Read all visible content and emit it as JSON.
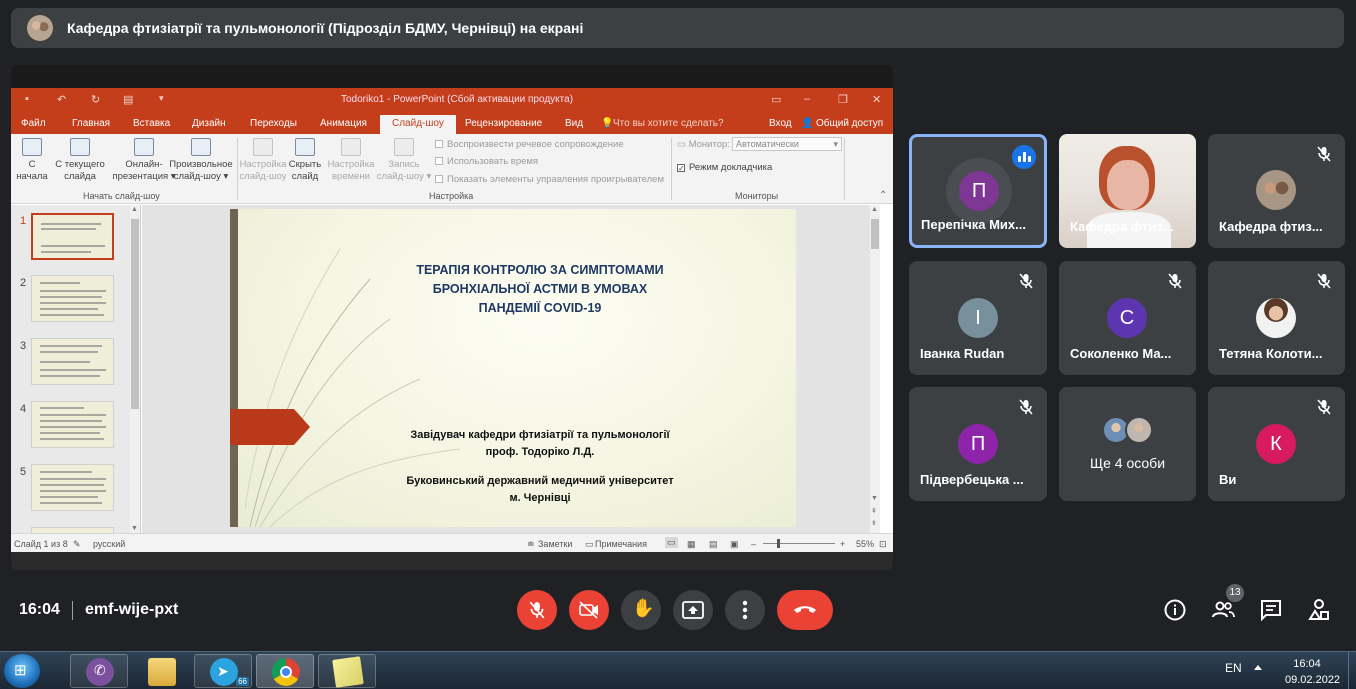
{
  "topbar": {
    "presenting_text": "Кафедра фтизіатрії та пульмонології (Підрозділ БДМУ, Чернівці) на екрані"
  },
  "ppt": {
    "window_title": "Todoriko1 - PowerPoint (Сбой активации продукта)",
    "tabs": [
      "Файл",
      "Главная",
      "Вставка",
      "Дизайн",
      "Переходы",
      "Анимация",
      "Слайд-шоу",
      "Рецензирование",
      "Вид"
    ],
    "active_tab": "Слайд-шоу",
    "tell_me": "Что вы хотите сделать?",
    "signin": "Вход",
    "share": "Общий доступ",
    "ribbon": {
      "from_start_1": "С",
      "from_start_2": "начала",
      "from_current_1": "С текущего",
      "from_current_2": "слайда",
      "online_1": "Онлайн-",
      "online_2": "презентация",
      "custom_1": "Произвольное",
      "custom_2": "слайд-шоу",
      "setup_1": "Настройка",
      "setup_2": "слайд-шоу",
      "hide_1": "Скрыть",
      "hide_2": "слайд",
      "rehearse_1": "Настройка",
      "rehearse_2": "времени",
      "record_1": "Запись",
      "record_2": "слайд-шоу",
      "chk_narration": "Воспроизвести речевое сопровождение",
      "chk_timings": "Использовать время",
      "chk_controls": "Показать элементы управления проигрывателем",
      "monitor_label": "Монитор:",
      "monitor_value": "Автоматически",
      "chk_presenter": "Режим докладчика",
      "group_start": "Начать слайд-шоу",
      "group_setup": "Настройка",
      "group_monitors": "Мониторы"
    },
    "thumbnails": [
      "1",
      "2",
      "3",
      "4",
      "5"
    ],
    "slide": {
      "title_line1": "ТЕРАПІЯ КОНТРОЛЮ ЗА СИМПТОМАМИ",
      "title_line2": "БРОНХІАЛЬНОЇ АСТМИ В УМОВАХ",
      "title_line3": "ПАНДЕМІЇ COVID-19",
      "author_line1": "Завідувач кафедри фтизіатрії та пульмонології",
      "author_line2": "проф. Тодоріко Л.Д.",
      "inst_line1": "Буковинський державний медичний університет",
      "inst_line2": "м. Чернівці"
    },
    "status": {
      "slide_count": "Слайд 1 из 8",
      "language": "русский",
      "notes": "Заметки",
      "comments": "Примечания",
      "zoom": "55%"
    }
  },
  "participants": [
    {
      "initial": "П",
      "name": "Перепічка Мих...",
      "color": "#7e3794",
      "speaking": true
    },
    {
      "initial": "",
      "name": "Кафедра фтиз...",
      "color": "",
      "speaking": false
    },
    {
      "initial": "",
      "name": "Кафедра фтиз...",
      "color": "",
      "speaking": false
    },
    {
      "initial": "І",
      "name": "Іванка Rudan",
      "color": "#78909c",
      "speaking": false
    },
    {
      "initial": "С",
      "name": "Соколенко Ма...",
      "color": "#5e35b1",
      "speaking": false
    },
    {
      "initial": "",
      "name": "Тетяна Колоти...",
      "color": "",
      "speaking": false
    },
    {
      "initial": "П",
      "name": "Підвербецька ...",
      "color": "#8e24aa",
      "speaking": false
    },
    {
      "initial": "",
      "name": "Ще 4 особи",
      "color": "",
      "speaking": false
    },
    {
      "initial": "К",
      "name": "Ви",
      "color": "#d81b60",
      "speaking": false
    }
  ],
  "controls": {
    "time": "16:04",
    "meeting_code": "emf-wije-pxt",
    "people_count": "13"
  },
  "taskbar": {
    "telegram_badge": "66",
    "language": "EN",
    "time": "16:04",
    "date": "09.02.2022"
  }
}
